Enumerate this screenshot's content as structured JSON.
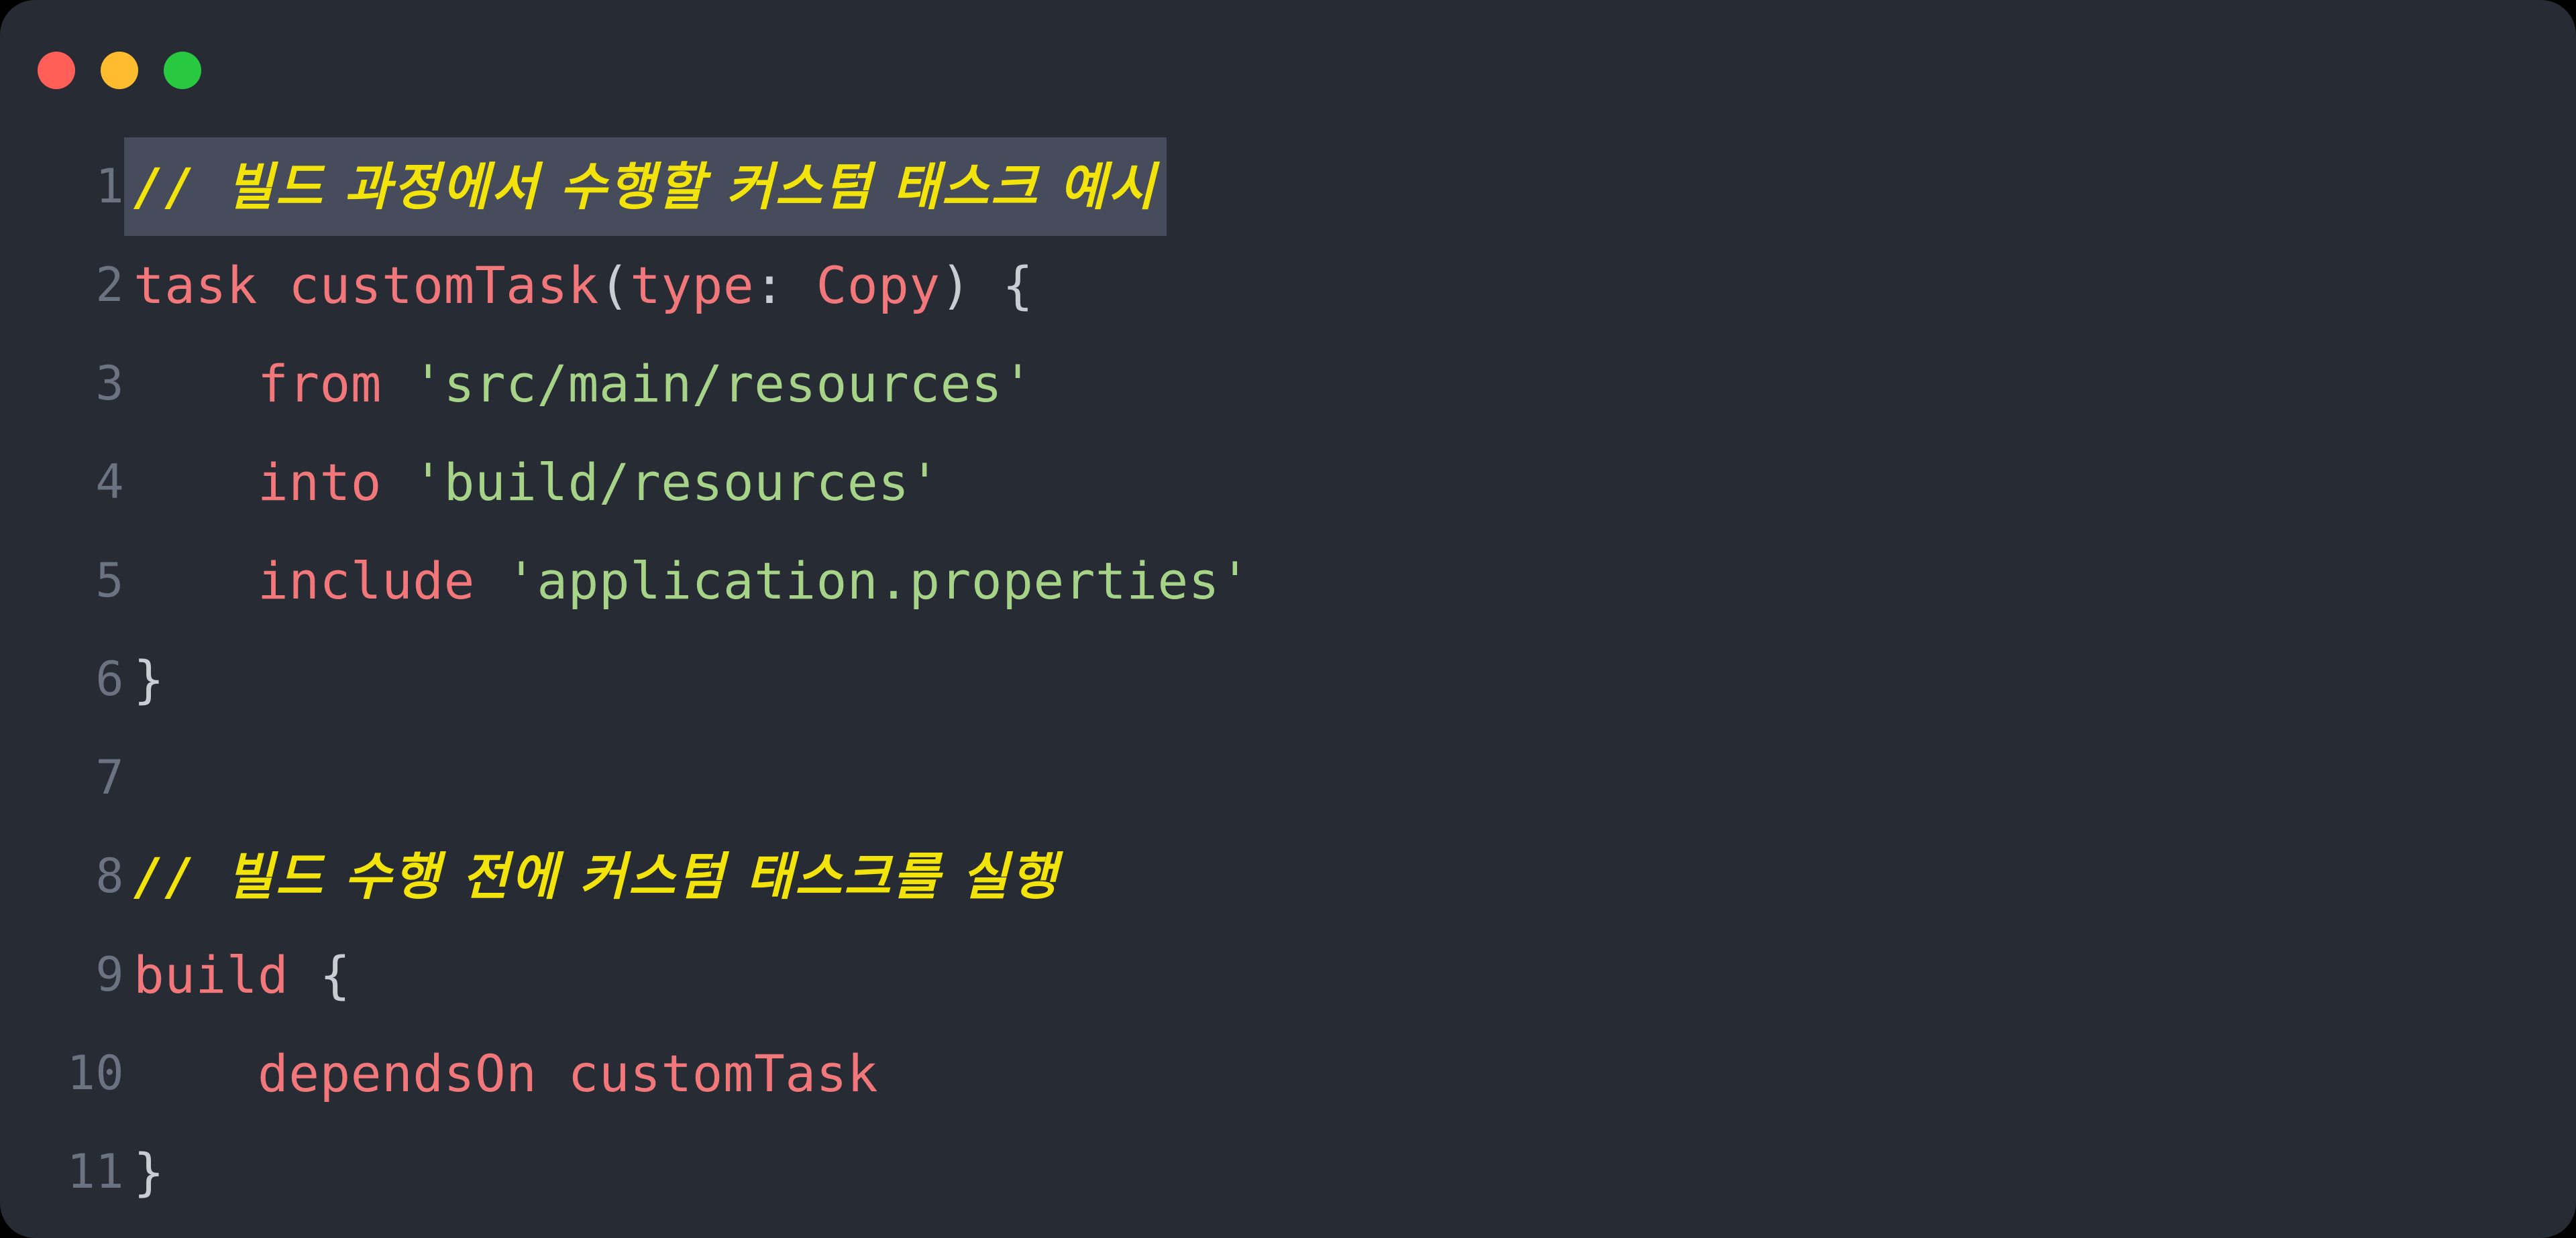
{
  "window": {
    "kind": "code-editor-snippet",
    "background_color": "#272b33",
    "corner_radius_px": 52,
    "traffic_lights": [
      {
        "name": "close",
        "color": "#ff5f57"
      },
      {
        "name": "minimize",
        "color": "#febc2e"
      },
      {
        "name": "maximize",
        "color": "#28c840"
      }
    ]
  },
  "editor": {
    "language": "groovy-gradle",
    "gutter_color": "#6b7280",
    "highlight_color": "#464c5c",
    "colors": {
      "comment": "#f2e30b",
      "keyword": "#f2777a",
      "string": "#a6d388",
      "punctuation": "#c9ccd3"
    },
    "lines": [
      {
        "number": "1",
        "highlighted": true,
        "text": "// 빌드 과정에서 수행할 커스텀 태스크 예시",
        "tokens": [
          {
            "t": "// ",
            "c": "comment"
          },
          {
            "t": "빌드 과정에서 수행할 커스텀 태스크 예시",
            "c": "comment-ko"
          }
        ]
      },
      {
        "number": "2",
        "highlighted": false,
        "text": "task customTask(type: Copy) {",
        "tokens": [
          {
            "t": "task customTask",
            "c": "kw"
          },
          {
            "t": "(",
            "c": "punct"
          },
          {
            "t": "type",
            "c": "kw"
          },
          {
            "t": ": ",
            "c": "punct"
          },
          {
            "t": "Copy",
            "c": "kw"
          },
          {
            "t": ") {",
            "c": "punct"
          }
        ]
      },
      {
        "number": "3",
        "highlighted": false,
        "text": "    from 'src/main/resources'",
        "tokens": [
          {
            "t": "    ",
            "c": "plain"
          },
          {
            "t": "from",
            "c": "kw"
          },
          {
            "t": " ",
            "c": "plain"
          },
          {
            "t": "'src/main/resources'",
            "c": "string"
          }
        ]
      },
      {
        "number": "4",
        "highlighted": false,
        "text": "    into 'build/resources'",
        "tokens": [
          {
            "t": "    ",
            "c": "plain"
          },
          {
            "t": "into",
            "c": "kw"
          },
          {
            "t": " ",
            "c": "plain"
          },
          {
            "t": "'build/resources'",
            "c": "string"
          }
        ]
      },
      {
        "number": "5",
        "highlighted": false,
        "text": "    include 'application.properties'",
        "tokens": [
          {
            "t": "    ",
            "c": "plain"
          },
          {
            "t": "include",
            "c": "kw"
          },
          {
            "t": " ",
            "c": "plain"
          },
          {
            "t": "'application.properties'",
            "c": "string"
          }
        ]
      },
      {
        "number": "6",
        "highlighted": false,
        "text": "}",
        "tokens": [
          {
            "t": "}",
            "c": "punct"
          }
        ]
      },
      {
        "number": "7",
        "highlighted": false,
        "text": "",
        "tokens": []
      },
      {
        "number": "8",
        "highlighted": false,
        "text": "// 빌드 수행 전에 커스텀 태스크를 실행",
        "tokens": [
          {
            "t": "// ",
            "c": "comment"
          },
          {
            "t": "빌드 수행 전에 커스텀 태스크를 실행",
            "c": "comment-ko"
          }
        ]
      },
      {
        "number": "9",
        "highlighted": false,
        "text": "build {",
        "tokens": [
          {
            "t": "build",
            "c": "kw"
          },
          {
            "t": " {",
            "c": "punct"
          }
        ]
      },
      {
        "number": "10",
        "highlighted": false,
        "text": "    dependsOn customTask",
        "tokens": [
          {
            "t": "    ",
            "c": "plain"
          },
          {
            "t": "dependsOn customTask",
            "c": "kw"
          }
        ]
      },
      {
        "number": "11",
        "highlighted": false,
        "text": "}",
        "tokens": [
          {
            "t": "}",
            "c": "punct"
          }
        ]
      }
    ]
  }
}
